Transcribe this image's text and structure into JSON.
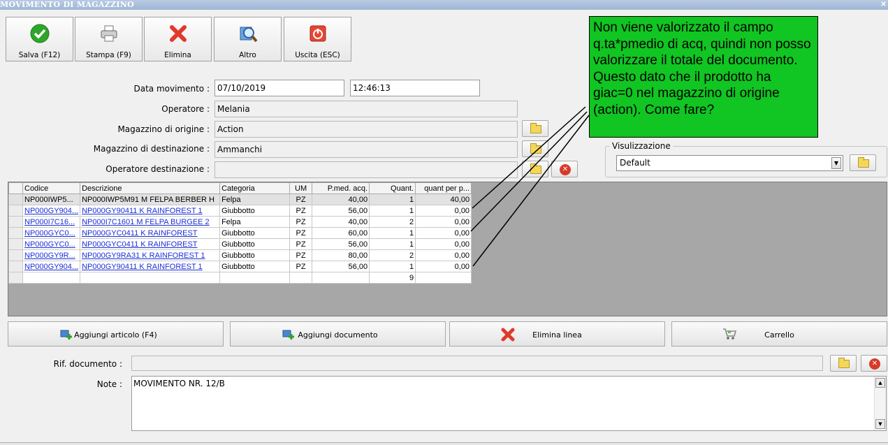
{
  "window": {
    "title": "MOVIMENTO DI MAGAZZINO"
  },
  "toolbar": [
    {
      "label": "Salva (F12)",
      "icon": "check-icon"
    },
    {
      "label": "Stampa (F9)",
      "icon": "printer-icon"
    },
    {
      "label": "Elimina",
      "icon": "delete-x-icon"
    },
    {
      "label": "Altro",
      "icon": "magnifier-icon"
    },
    {
      "label": "Uscita (ESC)",
      "icon": "power-icon"
    }
  ],
  "form": {
    "data_movimento_label": "Data movimento :",
    "data_movimento_date": "07/10/2019",
    "data_movimento_time": "12:46:13",
    "operatore_label": "Operatore :",
    "operatore_value": "Melania",
    "magazzino_origine_label": "Magazzino di origine :",
    "magazzino_origine_value": "Action",
    "magazzino_destinazione_label": "Magazzino di destinazione :",
    "magazzino_destinazione_value": "Ammanchi",
    "operatore_destinazione_label": "Operatore destinazione :",
    "operatore_destinazione_value": ""
  },
  "visualizzazione": {
    "label": "Visulizzazione",
    "selected": "Default"
  },
  "callout": {
    "text": "Non viene valorizzato il campo q.ta*pmedio di acq, quindi non posso valorizzare il totale del documento. Questo dato che il prodotto ha giac=0 nel magazzino di origine (action). Come fare?"
  },
  "grid": {
    "headers": [
      "Codice",
      "Descrizione",
      "Categoria",
      "UM",
      "P.med. acq.",
      "Quant.",
      "quant per p..."
    ],
    "rows": [
      {
        "codice": "NP000IWP5...",
        "descrizione": "NP000IWP5M91 M FELPA BERBER H",
        "categoria": "Felpa",
        "um": "PZ",
        "pmed": "40,00",
        "quant": "1",
        "quantper": "40,00"
      },
      {
        "codice": "NP000GY904...",
        "descrizione": "NP000GY90411 K RAINFOREST 1",
        "categoria": "Giubbotto",
        "um": "PZ",
        "pmed": "56,00",
        "quant": "1",
        "quantper": "0,00"
      },
      {
        "codice": "NP000I7C16...",
        "descrizione": "NP000I7C1601 M FELPA BURGEE 2",
        "categoria": "Felpa",
        "um": "PZ",
        "pmed": "40,00",
        "quant": "2",
        "quantper": "0,00"
      },
      {
        "codice": "NP000GYC0...",
        "descrizione": "NP000GYC0411 K RAINFOREST",
        "categoria": "Giubbotto",
        "um": "PZ",
        "pmed": "60,00",
        "quant": "1",
        "quantper": "0,00"
      },
      {
        "codice": "NP000GYC0...",
        "descrizione": "NP000GYC0411 K RAINFOREST",
        "categoria": "Giubbotto",
        "um": "PZ",
        "pmed": "56,00",
        "quant": "1",
        "quantper": "0,00"
      },
      {
        "codice": "NP000GY9R...",
        "descrizione": "NP000GY9RA31 K RAINFOREST 1",
        "categoria": "Giubbotto",
        "um": "PZ",
        "pmed": "80,00",
        "quant": "2",
        "quantper": "0,00"
      },
      {
        "codice": "NP000GY904...",
        "descrizione": "NP000GY90411 K RAINFOREST 1",
        "categoria": "Giubbotto",
        "um": "PZ",
        "pmed": "56,00",
        "quant": "1",
        "quantper": "0,00"
      }
    ],
    "total_quant": "9"
  },
  "actions": [
    {
      "label": "Aggiungi articolo (F4)",
      "icon": "add-item-icon"
    },
    {
      "label": "Aggiungi documento",
      "icon": "add-document-icon"
    },
    {
      "label": "Elimina linea",
      "icon": "delete-line-icon"
    },
    {
      "label": "Carrello",
      "icon": "cart-icon"
    }
  ],
  "footer": {
    "rif_label": "Rif. documento :",
    "rif_value": "",
    "note_label": "Note :",
    "note_value": "MOVIMENTO NR. 12/B"
  },
  "colors": {
    "callout_bg": "#11c522",
    "link": "#1b2fd6",
    "grid_bg": "#a7a7a7"
  }
}
